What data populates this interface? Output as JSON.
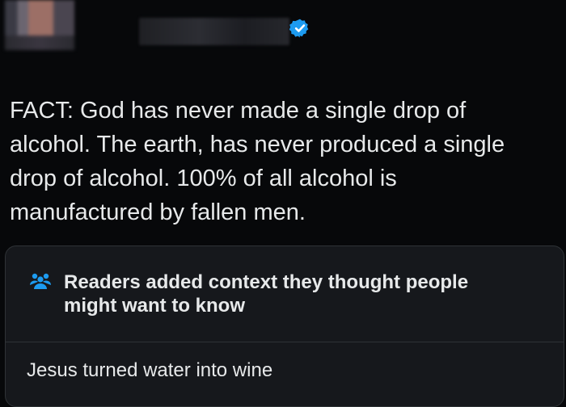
{
  "tweet": {
    "text": "FACT: God has never made a single drop of\nalcohol. The earth, has never produced a single\ndrop of alcohol. 100% of all alcohol is\nmanufactured by fallen men."
  },
  "community_note": {
    "title": "Readers added context they thought people\nmight want to know",
    "body": "Jesus turned water into wine",
    "icon": "people-icon"
  },
  "colors": {
    "background": "#07080a",
    "verified": "#1d9bf0",
    "note_icon": "#1d9bf0",
    "note_background": "#16181c"
  }
}
